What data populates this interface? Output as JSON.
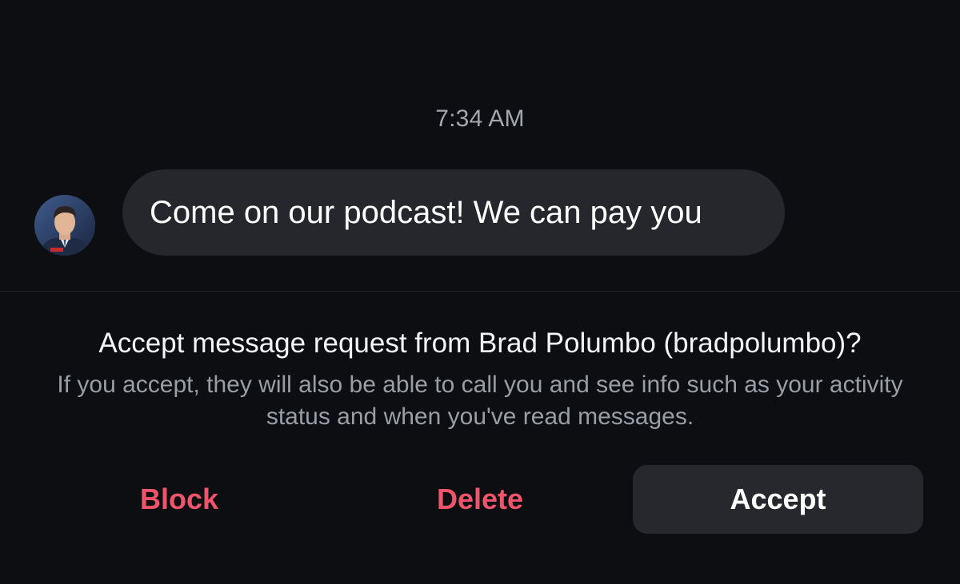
{
  "conversation": {
    "timestamp": "7:34 AM",
    "message": {
      "text": "Come on our podcast! We can pay you",
      "sender_avatar": "profile-photo"
    }
  },
  "request": {
    "title": "Accept message request from Brad Polumbo (bradpolumbo)?",
    "subtitle": "If you accept, they will also be able to call you and see info such as your activity status and when you've read messages."
  },
  "actions": {
    "block_label": "Block",
    "delete_label": "Delete",
    "accept_label": "Accept"
  },
  "colors": {
    "background": "#0c0e12",
    "bubble": "#25272c",
    "destructive": "#f0546a",
    "accept_button": "#26282d",
    "secondary_text": "#9a9da4"
  }
}
